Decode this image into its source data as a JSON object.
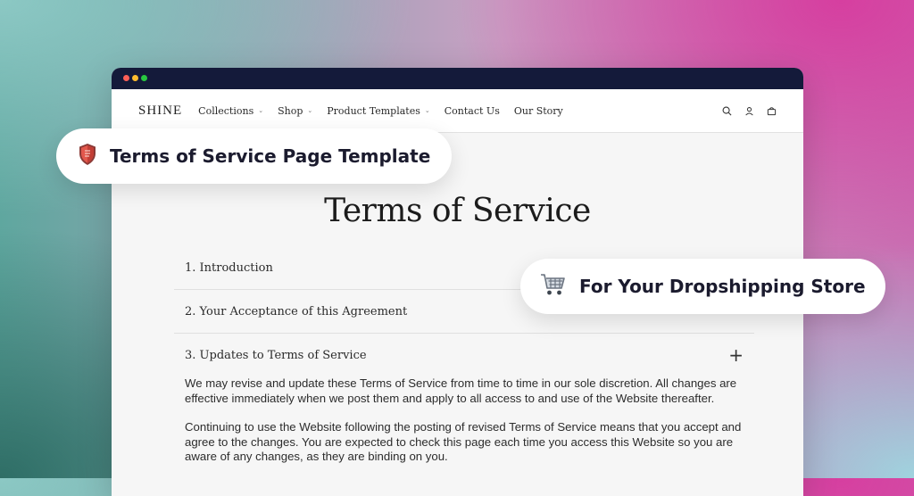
{
  "window": {
    "title_dots": [
      "red",
      "yellow",
      "green"
    ]
  },
  "nav": {
    "logo": "SHINE",
    "items": [
      {
        "label": "Collections",
        "has_dropdown": true
      },
      {
        "label": "Shop",
        "has_dropdown": true
      },
      {
        "label": "Product Templates",
        "has_dropdown": true
      },
      {
        "label": "Contact Us",
        "has_dropdown": false
      },
      {
        "label": "Our Story",
        "has_dropdown": false
      }
    ],
    "icons": [
      "search-icon",
      "user-icon",
      "cart-icon"
    ]
  },
  "page": {
    "title": "Terms of Service",
    "sections": [
      {
        "title": "1. Introduction"
      },
      {
        "title": "2. Your Acceptance of this Agreement"
      },
      {
        "title": "3. Updates to Terms of Service",
        "expand_symbol": "+",
        "paragraphs": [
          "We may revise and update these Terms of Service from time to time in our sole discretion. All changes are effective immediately when we post them and apply to all access to and use of the Website thereafter.",
          "Continuing to use the Website following the posting of revised Terms of Service means that you accept and agree to the changes. You are expected to check this page each time you access this Website so you are aware of any changes, as they are binding on you."
        ]
      }
    ]
  },
  "badges": {
    "template": {
      "label": "Terms of Service Page Template",
      "icon": "shield-icon"
    },
    "store": {
      "label": "For Your Dropshipping Store",
      "icon": "shopping-cart-icon"
    }
  },
  "colors": {
    "titlebar": "#141a3a",
    "text": "#1b1b2e",
    "shield_red": "#d9443a"
  }
}
